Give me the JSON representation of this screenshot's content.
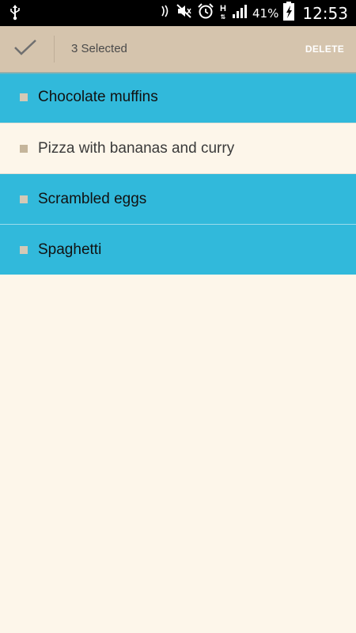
{
  "status_bar": {
    "network_type": "H",
    "battery_percent": "41%",
    "time": "12:53",
    "icons": [
      "usb-icon",
      "nfc-icon",
      "mute-icon",
      "alarm-icon",
      "network-h-icon",
      "signal-icon",
      "battery-charging-icon"
    ]
  },
  "action_bar": {
    "selected_text": "3 Selected",
    "delete_label": "DELETE",
    "done_icon": "check-icon",
    "background": "#d5c4ad"
  },
  "list": {
    "items": [
      {
        "label": "Chocolate muffins",
        "selected": true
      },
      {
        "label": "Pizza with bananas and curry",
        "selected": false
      },
      {
        "label": "Scrambled eggs",
        "selected": true
      },
      {
        "label": "Spaghetti",
        "selected": true
      }
    ]
  },
  "colors": {
    "selected": "#31b9db",
    "background": "#fdf6ea",
    "bullet": "#c5b59b"
  }
}
